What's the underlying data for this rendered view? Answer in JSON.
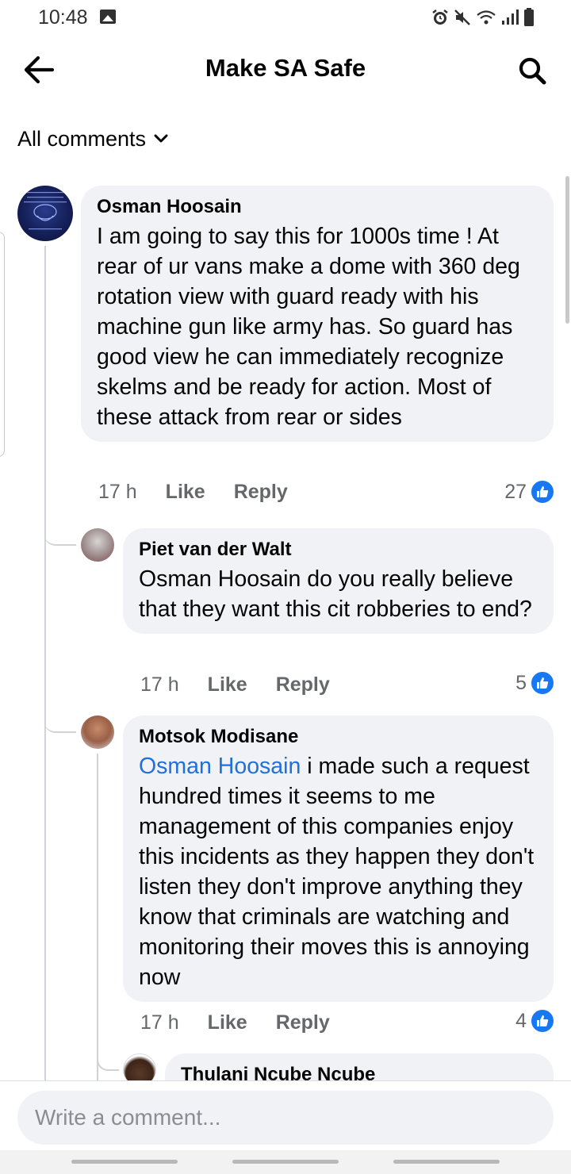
{
  "status_bar": {
    "time": "10:48",
    "icons": [
      "gallery-icon",
      "alarm-icon",
      "mute-icon",
      "wifi-icon",
      "signal-icon",
      "battery-icon"
    ]
  },
  "header": {
    "title": "Make SA Safe",
    "back_icon": "arrow-left-icon",
    "search_icon": "search-icon"
  },
  "filter": {
    "label": "All comments",
    "icon": "chevron-down-icon"
  },
  "comments": [
    {
      "author": "Osman Hoosain",
      "text": "I am going to say this for 1000s time !  At rear of ur vans make a dome with 360 deg rotation view with guard ready with his machine gun like army has. So guard has good view he can immediately recognize skelms and be ready for action.   Most of these attack from rear or sides",
      "time": "17 h",
      "like_label": "Like",
      "reply_label": "Reply",
      "likes": "27"
    },
    {
      "author": "Piet van der Walt",
      "text": "Osman Hoosain do you really believe that they want this cit robberies to end?",
      "time": "17 h",
      "like_label": "Like",
      "reply_label": "Reply",
      "likes": "5"
    },
    {
      "author": "Motsok Modisane",
      "mention": "Osman Hoosain",
      "text": " i made such a request hundred times it seems to me management of this companies enjoy this incidents as they happen they don't listen they don't improve anything they know that criminals are watching and monitoring their moves this is annoying now",
      "time": "17 h",
      "like_label": "Like",
      "reply_label": "Reply",
      "likes": "4"
    },
    {
      "author": "Thulani Ncube Ncube"
    }
  ],
  "composer": {
    "placeholder": "Write a comment..."
  },
  "colors": {
    "accent": "#1877f2",
    "mention": "#216fdb",
    "bubble": "#f0f2f5",
    "meta": "#65676b"
  }
}
